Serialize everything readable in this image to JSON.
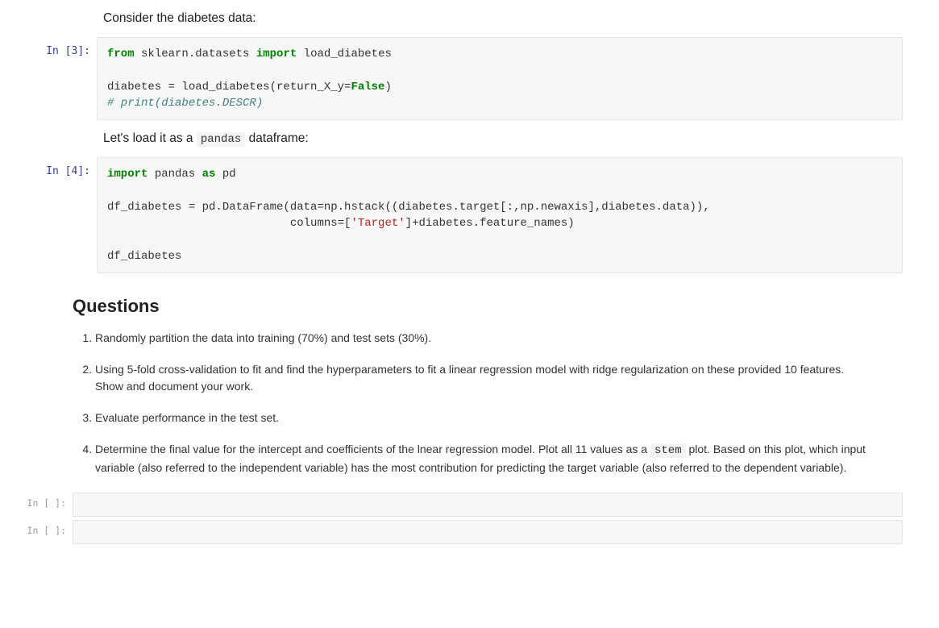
{
  "md1": {
    "text": "Consider the diabetes data:"
  },
  "cell3": {
    "prompt": "In [3]:",
    "line1_kw1": "from",
    "line1_mod": " sklearn.datasets ",
    "line1_kw2": "import",
    "line1_name": " load_diabetes",
    "line3a": "diabetes = load_diabetes(return_X_y=",
    "line3_bool": "False",
    "line3b": ")",
    "line4_comment": "# print(diabetes.DESCR)"
  },
  "md2": {
    "t1": "Let's load it as a ",
    "code": "pandas",
    "t2": " dataframe:"
  },
  "cell4": {
    "prompt": "In [4]:",
    "line1_kw": "import",
    "line1_mod": " pandas ",
    "line1_kw2": "as",
    "line1_alias": " pd",
    "line3": "df_diabetes = pd.DataFrame(data=np.hstack((diabetes.target[:,np.newaxis],diabetes.data)),",
    "line4a": "                           columns=[",
    "line4_str": "'Target'",
    "line4b": "]+diabetes.feature_names)",
    "line6": "df_diabetes"
  },
  "questions": {
    "heading": "Questions",
    "items": [
      "Randomly partition the data into training (70%) and test sets (30%).",
      "Using 5-fold cross-validation to fit and find the hyperparameters to fit a linear regression model with ridge regularization on these provided 10 features. Show and document your work.",
      "Evaluate performance in the test set.",
      {
        "t1": "Determine the final value for the intercept and coefficients of the lnear regression model. Plot all 11 values as a ",
        "code": "stem",
        "t2": " plot. Based on this plot, which input variable (also referred to the independent variable) has the most contribution for predicting the target variable (also referred to the dependent variable)."
      }
    ]
  },
  "emptyPrompt": "In [ ]:"
}
